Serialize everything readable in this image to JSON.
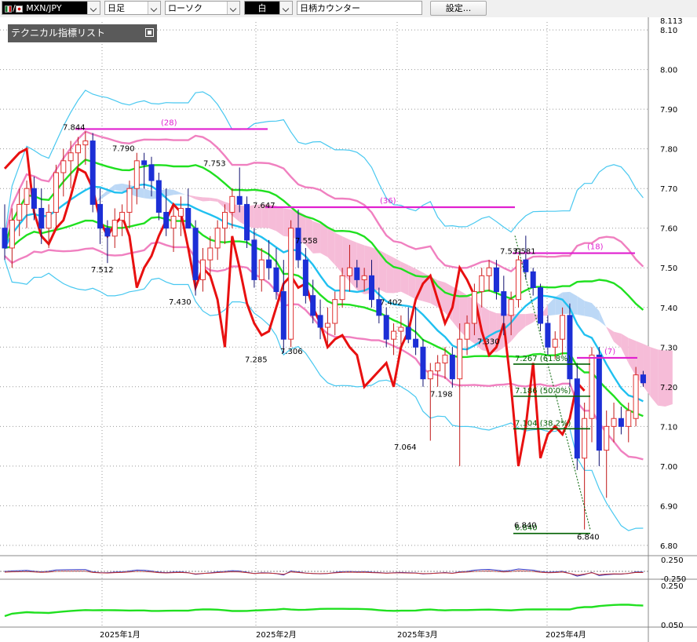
{
  "toolbar": {
    "symbol": "MXN/JPY",
    "period": "日足",
    "chart_type": "ローソク",
    "color_mode": "白",
    "search_placeholder": "日柄カウンター",
    "settings_label": "設定..."
  },
  "indicator_list_label": "テクニカル指標リスト",
  "colors": {
    "up_candle": "#e03030",
    "down_candle": "#1c2fd6",
    "cloud": "#f6bcd8",
    "cloud_blue": "#bcd8f6",
    "bollinger_outer": "#48c8f0",
    "bollinger_inner": "#f080c0",
    "midline": "#20e020",
    "ma_blue": "#20c0f0",
    "red_line": "#e81010",
    "magenta": "#e020d0",
    "fib": "#006000"
  },
  "chart_data": {
    "type": "candlestick",
    "y_axis_labels": [
      "8.113",
      "8.10",
      "8.00",
      "7.90",
      "7.80",
      "7.70",
      "7.60",
      "7.50",
      "7.40",
      "7.30",
      "7.20",
      "7.10",
      "7.00",
      "6.90",
      "6.80"
    ],
    "ylim": [
      6.78,
      8.12
    ],
    "x_axis_labels": [
      "2025年1月",
      "2025年2月",
      "2025年3月",
      "2025年4月"
    ],
    "price_annotations": [
      "7.844",
      "7.790",
      "7.753",
      "7.647",
      "7.558",
      "7.512",
      "7.430",
      "7.402",
      "7.306",
      "7.285",
      "7.330",
      "7.531",
      "7.581",
      "7.198",
      "7.064",
      "6.840",
      "6.840"
    ],
    "fibonacci": [
      {
        "label": "7.267 (61.8%)",
        "value": 7.267
      },
      {
        "label": "7.186 (50.0%)",
        "value": 7.186
      },
      {
        "label": "7.104 (38.2%)",
        "value": 7.104
      },
      {
        "label": "6.840",
        "value": 6.84
      }
    ],
    "day_counters": [
      "(28)",
      "(36)",
      "(18)",
      "(7)"
    ],
    "sub1_labels": [
      "0.250",
      "-0.250"
    ],
    "sub2_labels": [
      "0.250",
      "0.050"
    ],
    "candles": [
      {
        "o": 7.6,
        "h": 7.66,
        "l": 7.52,
        "c": 7.55
      },
      {
        "o": 7.55,
        "h": 7.65,
        "l": 7.5,
        "c": 7.62
      },
      {
        "o": 7.62,
        "h": 7.7,
        "l": 7.58,
        "c": 7.66
      },
      {
        "o": 7.66,
        "h": 7.72,
        "l": 7.6,
        "c": 7.7
      },
      {
        "o": 7.7,
        "h": 7.73,
        "l": 7.62,
        "c": 7.65
      },
      {
        "o": 7.65,
        "h": 7.7,
        "l": 7.56,
        "c": 7.6
      },
      {
        "o": 7.6,
        "h": 7.66,
        "l": 7.55,
        "c": 7.64
      },
      {
        "o": 7.64,
        "h": 7.76,
        "l": 7.6,
        "c": 7.74
      },
      {
        "o": 7.74,
        "h": 7.8,
        "l": 7.68,
        "c": 7.77
      },
      {
        "o": 7.77,
        "h": 7.82,
        "l": 7.7,
        "c": 7.79
      },
      {
        "o": 7.79,
        "h": 7.83,
        "l": 7.74,
        "c": 7.81
      },
      {
        "o": 7.81,
        "h": 7.844,
        "l": 7.76,
        "c": 7.82
      },
      {
        "o": 7.82,
        "h": 7.84,
        "l": 7.64,
        "c": 7.66
      },
      {
        "o": 7.66,
        "h": 7.7,
        "l": 7.56,
        "c": 7.6
      },
      {
        "o": 7.6,
        "h": 7.62,
        "l": 7.512,
        "c": 7.58
      },
      {
        "o": 7.58,
        "h": 7.65,
        "l": 7.55,
        "c": 7.62
      },
      {
        "o": 7.62,
        "h": 7.66,
        "l": 7.58,
        "c": 7.64
      },
      {
        "o": 7.64,
        "h": 7.72,
        "l": 7.6,
        "c": 7.7
      },
      {
        "o": 7.7,
        "h": 7.79,
        "l": 7.66,
        "c": 7.77
      },
      {
        "o": 7.77,
        "h": 7.79,
        "l": 7.7,
        "c": 7.76
      },
      {
        "o": 7.76,
        "h": 7.78,
        "l": 7.68,
        "c": 7.72
      },
      {
        "o": 7.72,
        "h": 7.74,
        "l": 7.62,
        "c": 7.64
      },
      {
        "o": 7.64,
        "h": 7.7,
        "l": 7.58,
        "c": 7.6
      },
      {
        "o": 7.6,
        "h": 7.66,
        "l": 7.54,
        "c": 7.63
      },
      {
        "o": 7.63,
        "h": 7.68,
        "l": 7.58,
        "c": 7.65
      },
      {
        "o": 7.65,
        "h": 7.7,
        "l": 7.6,
        "c": 7.6
      },
      {
        "o": 7.6,
        "h": 7.62,
        "l": 7.43,
        "c": 7.47
      },
      {
        "o": 7.47,
        "h": 7.55,
        "l": 7.44,
        "c": 7.52
      },
      {
        "o": 7.52,
        "h": 7.58,
        "l": 7.48,
        "c": 7.55
      },
      {
        "o": 7.55,
        "h": 7.62,
        "l": 7.52,
        "c": 7.6
      },
      {
        "o": 7.6,
        "h": 7.66,
        "l": 7.56,
        "c": 7.64
      },
      {
        "o": 7.64,
        "h": 7.7,
        "l": 7.6,
        "c": 7.68
      },
      {
        "o": 7.68,
        "h": 7.753,
        "l": 7.64,
        "c": 7.66
      },
      {
        "o": 7.66,
        "h": 7.68,
        "l": 7.55,
        "c": 7.57
      },
      {
        "o": 7.57,
        "h": 7.6,
        "l": 7.45,
        "c": 7.47
      },
      {
        "o": 7.47,
        "h": 7.55,
        "l": 7.44,
        "c": 7.52
      },
      {
        "o": 7.52,
        "h": 7.57,
        "l": 7.47,
        "c": 7.5
      },
      {
        "o": 7.5,
        "h": 7.55,
        "l": 7.42,
        "c": 7.44
      },
      {
        "o": 7.44,
        "h": 7.52,
        "l": 7.285,
        "c": 7.32
      },
      {
        "o": 7.32,
        "h": 7.62,
        "l": 7.3,
        "c": 7.6
      },
      {
        "o": 7.6,
        "h": 7.647,
        "l": 7.5,
        "c": 7.52
      },
      {
        "o": 7.52,
        "h": 7.55,
        "l": 7.41,
        "c": 7.43
      },
      {
        "o": 7.43,
        "h": 7.47,
        "l": 7.36,
        "c": 7.38
      },
      {
        "o": 7.38,
        "h": 7.42,
        "l": 7.32,
        "c": 7.35
      },
      {
        "o": 7.35,
        "h": 7.4,
        "l": 7.306,
        "c": 7.36
      },
      {
        "o": 7.36,
        "h": 7.44,
        "l": 7.33,
        "c": 7.42
      },
      {
        "o": 7.42,
        "h": 7.5,
        "l": 7.4,
        "c": 7.48
      },
      {
        "o": 7.48,
        "h": 7.558,
        "l": 7.44,
        "c": 7.5
      },
      {
        "o": 7.5,
        "h": 7.52,
        "l": 7.45,
        "c": 7.47
      },
      {
        "o": 7.47,
        "h": 7.5,
        "l": 7.44,
        "c": 7.48
      },
      {
        "o": 7.48,
        "h": 7.52,
        "l": 7.4,
        "c": 7.42
      },
      {
        "o": 7.42,
        "h": 7.45,
        "l": 7.36,
        "c": 7.38
      },
      {
        "o": 7.38,
        "h": 7.4,
        "l": 7.3,
        "c": 7.32
      },
      {
        "o": 7.32,
        "h": 7.36,
        "l": 7.28,
        "c": 7.34
      },
      {
        "o": 7.34,
        "h": 7.38,
        "l": 7.3,
        "c": 7.35
      },
      {
        "o": 7.35,
        "h": 7.4,
        "l": 7.31,
        "c": 7.32
      },
      {
        "o": 7.32,
        "h": 7.402,
        "l": 7.28,
        "c": 7.3
      },
      {
        "o": 7.3,
        "h": 7.32,
        "l": 7.2,
        "c": 7.22
      },
      {
        "o": 7.22,
        "h": 7.26,
        "l": 7.064,
        "c": 7.24
      },
      {
        "o": 7.24,
        "h": 7.28,
        "l": 7.2,
        "c": 7.26
      },
      {
        "o": 7.26,
        "h": 7.3,
        "l": 7.22,
        "c": 7.28
      },
      {
        "o": 7.28,
        "h": 7.3,
        "l": 7.198,
        "c": 7.22
      },
      {
        "o": 7.22,
        "h": 7.36,
        "l": 7.0,
        "c": 7.32
      },
      {
        "o": 7.32,
        "h": 7.38,
        "l": 7.28,
        "c": 7.36
      },
      {
        "o": 7.36,
        "h": 7.46,
        "l": 7.33,
        "c": 7.44
      },
      {
        "o": 7.44,
        "h": 7.5,
        "l": 7.4,
        "c": 7.48
      },
      {
        "o": 7.48,
        "h": 7.52,
        "l": 7.44,
        "c": 7.5
      },
      {
        "o": 7.5,
        "h": 7.52,
        "l": 7.42,
        "c": 7.44
      },
      {
        "o": 7.44,
        "h": 7.48,
        "l": 7.33,
        "c": 7.38
      },
      {
        "o": 7.38,
        "h": 7.44,
        "l": 7.33,
        "c": 7.42
      },
      {
        "o": 7.42,
        "h": 7.531,
        "l": 7.4,
        "c": 7.52
      },
      {
        "o": 7.52,
        "h": 7.581,
        "l": 7.47,
        "c": 7.49
      },
      {
        "o": 7.49,
        "h": 7.5,
        "l": 7.43,
        "c": 7.45
      },
      {
        "o": 7.45,
        "h": 7.46,
        "l": 7.34,
        "c": 7.36
      },
      {
        "o": 7.36,
        "h": 7.38,
        "l": 7.28,
        "c": 7.3
      },
      {
        "o": 7.3,
        "h": 7.34,
        "l": 7.27,
        "c": 7.32
      },
      {
        "o": 7.32,
        "h": 7.4,
        "l": 7.28,
        "c": 7.38
      },
      {
        "o": 7.38,
        "h": 7.41,
        "l": 7.2,
        "c": 7.22
      },
      {
        "o": 7.22,
        "h": 7.26,
        "l": 6.99,
        "c": 7.02
      },
      {
        "o": 7.02,
        "h": 7.16,
        "l": 6.84,
        "c": 7.12
      },
      {
        "o": 7.12,
        "h": 7.3,
        "l": 7.06,
        "c": 7.28
      },
      {
        "o": 7.28,
        "h": 7.3,
        "l": 7.0,
        "c": 7.04
      },
      {
        "o": 7.04,
        "h": 7.14,
        "l": 6.92,
        "c": 7.1
      },
      {
        "o": 7.1,
        "h": 7.16,
        "l": 7.06,
        "c": 7.12
      },
      {
        "o": 7.12,
        "h": 7.15,
        "l": 7.08,
        "c": 7.1
      },
      {
        "o": 7.1,
        "h": 7.16,
        "l": 7.06,
        "c": 7.14
      },
      {
        "o": 7.12,
        "h": 7.25,
        "l": 7.1,
        "c": 7.23
      },
      {
        "o": 7.23,
        "h": 7.24,
        "l": 7.2,
        "c": 7.21
      }
    ]
  }
}
